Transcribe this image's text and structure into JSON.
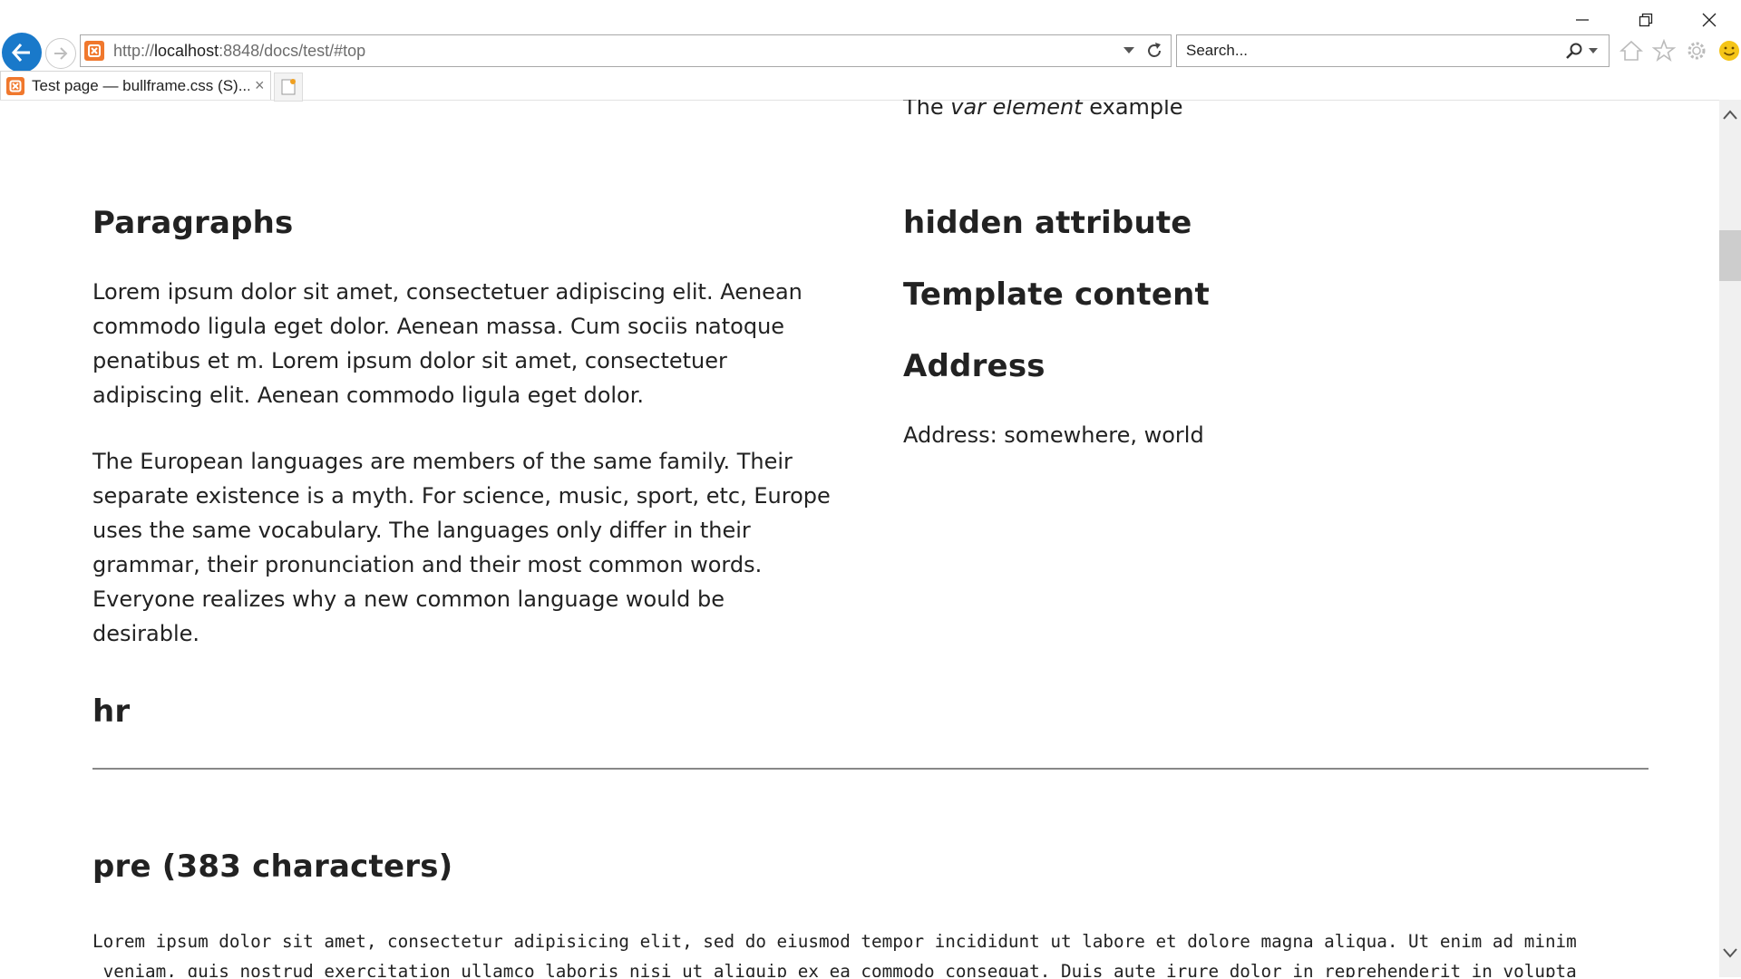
{
  "browser": {
    "url_prefix": "http://",
    "url_host": "localhost",
    "url_rest": ":8848/docs/test/#top",
    "search_placeholder": "Search...",
    "tab_title": "Test page — bullframe.css (S)...",
    "tab_close": "×",
    "window_buttons": [
      "minimize-icon",
      "restore-icon",
      "close-icon"
    ],
    "toolbar_icons": [
      "home-icon",
      "favorites-star-icon",
      "settings-gear-icon",
      "smiley-feedback-icon"
    ],
    "accent_color": "#1979ca",
    "site_icon_color": "#f0782d"
  },
  "page": {
    "var_line": {
      "before": "The ",
      "em": "var element",
      "after": " example"
    },
    "left": {
      "paragraphs_heading": "Paragraphs",
      "paragraph_1": "Lorem ipsum dolor sit amet, consectetuer adipiscing elit. Aenean commodo ligula eget dolor. Aenean massa. Cum sociis natoque penatibus et m. Lorem ipsum dolor sit amet, consectetuer adipiscing elit. Aenean commodo ligula eget dolor.",
      "paragraph_2": "The European languages are members of the same family. Their separate existence is a myth. For science, music, sport, etc, Europe uses the same vocabulary. The languages only differ in their grammar, their pronunciation and their most common words. Everyone realizes why a new common language would be desirable."
    },
    "right": {
      "hidden_heading": "hidden attribute",
      "template_heading": "Template content",
      "address_heading": "Address",
      "address_text": "Address: somewhere, world"
    },
    "hr_heading": "hr",
    "pre_heading": "pre (383 characters)",
    "pre_line_1": "Lorem ipsum dolor sit amet, consectetur adipisicing elit, sed do eiusmod tempor incididunt ut labore et dolore magna aliqua. Ut enim ad minim",
    "pre_line_2": " veniam, quis nostrud exercitation ullamco laboris nisi ut aliquip ex ea commodo consequat. Duis aute irure dolor in reprehenderit in volupta"
  }
}
